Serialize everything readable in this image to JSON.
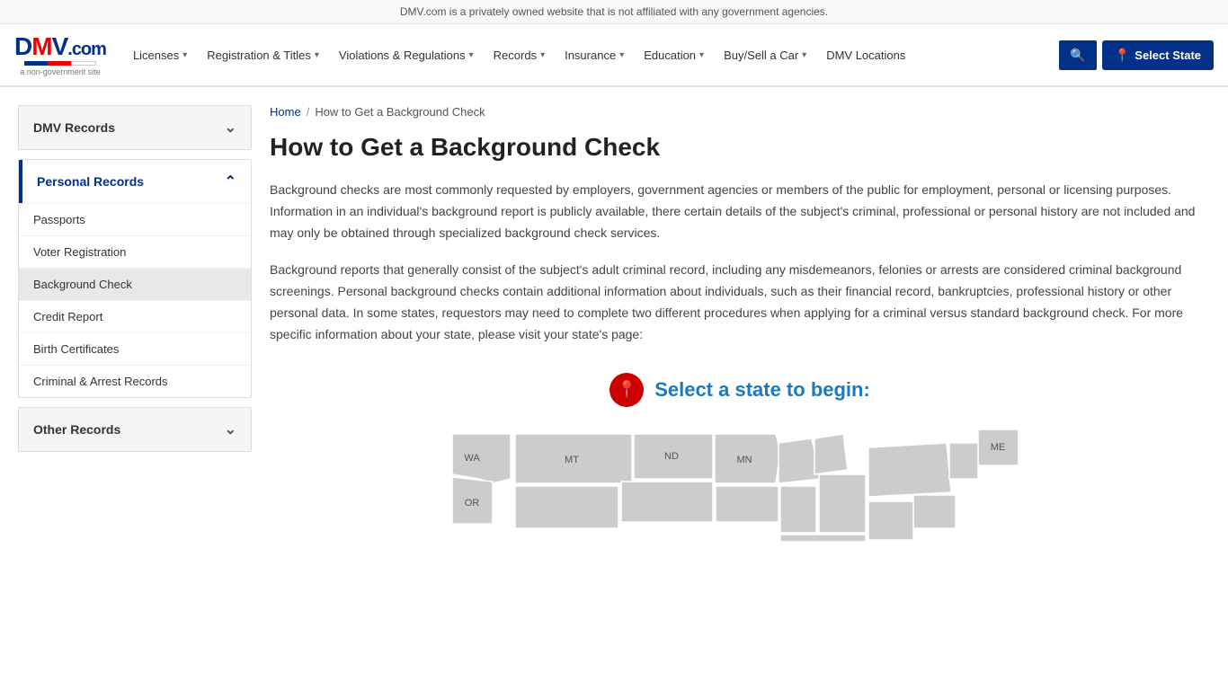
{
  "notice": {
    "text": "DMV.com is a privately owned website that is not affiliated with any government agencies."
  },
  "header": {
    "logo": {
      "text": "DMV.com",
      "sub": "a non-government site"
    },
    "nav_items": [
      {
        "label": "Licenses",
        "has_dropdown": true
      },
      {
        "label": "Registration & Titles",
        "has_dropdown": true
      },
      {
        "label": "Violations & Regulations",
        "has_dropdown": true
      },
      {
        "label": "Records",
        "has_dropdown": true
      },
      {
        "label": "Insurance",
        "has_dropdown": true
      },
      {
        "label": "Education",
        "has_dropdown": true
      },
      {
        "label": "Buy/Sell a Car",
        "has_dropdown": true
      },
      {
        "label": "DMV Locations",
        "has_dropdown": false
      }
    ],
    "select_state_label": "Select State"
  },
  "sidebar": {
    "sections": [
      {
        "id": "dmv-records",
        "label": "DMV Records",
        "expanded": false,
        "active": false
      },
      {
        "id": "personal-records",
        "label": "Personal Records",
        "expanded": true,
        "active": true,
        "links": [
          {
            "label": "Passports",
            "active": false
          },
          {
            "label": "Voter Registration",
            "active": false
          },
          {
            "label": "Background Check",
            "active": true
          },
          {
            "label": "Credit Report",
            "active": false
          },
          {
            "label": "Birth Certificates",
            "active": false
          },
          {
            "label": "Criminal & Arrest Records",
            "active": false
          }
        ]
      },
      {
        "id": "other-records",
        "label": "Other Records",
        "expanded": false,
        "active": false
      }
    ]
  },
  "breadcrumb": {
    "home": "Home",
    "separator": "/",
    "current": "How to Get a Background Check"
  },
  "main": {
    "title": "How to Get a Background Check",
    "paragraphs": [
      "Background checks are most commonly requested by employers, government agencies or members of the public for employment, personal or licensing purposes. Information in an individual's background report is publicly available, there certain details of the subject's criminal, professional or personal history are not included and may only be obtained through specialized background check services.",
      "Background reports that generally consist of the subject's adult criminal record, including any misdemeanors, felonies or arrests are considered criminal background screenings. Personal background checks contain additional information about individuals, such as their financial record, bankruptcies, professional history or other personal data. In some states, requestors may need to complete two different procedures when applying for a criminal versus standard background check. For more specific information about your state, please visit your state's page:"
    ],
    "state_select": {
      "heading": "Select a state to begin:",
      "map_labels": [
        "WA",
        "MT",
        "ND",
        "MN",
        "ME",
        "OR"
      ]
    }
  }
}
